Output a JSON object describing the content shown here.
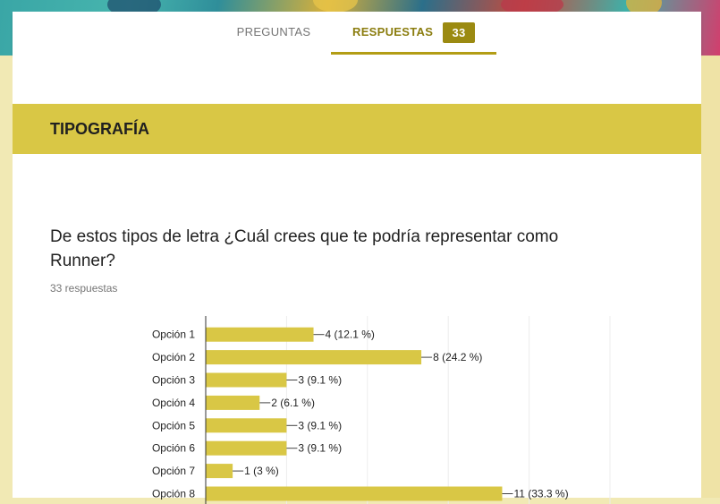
{
  "tabs": {
    "questions_label": "PREGUNTAS",
    "responses_label": "RESPUESTAS",
    "responses_count": "33"
  },
  "section": {
    "title": "TIPOGRAFÍA"
  },
  "question": {
    "text": "De estos tipos de letra ¿Cuál crees que te podría representar como Runner?",
    "responses_summary": "33 respuestas"
  },
  "colors": {
    "accent": "#d9c745",
    "badge": "#9b8a11",
    "bar": "#d9c745"
  },
  "chart_data": {
    "type": "bar",
    "orientation": "horizontal",
    "categories": [
      "Opción 1",
      "Opción 2",
      "Opción 3",
      "Opción 4",
      "Opción 5",
      "Opción 6",
      "Opción 7",
      "Opción 8"
    ],
    "values": [
      4,
      8,
      3,
      2,
      3,
      3,
      1,
      11
    ],
    "labels": [
      "4 (12.1 %)",
      "8 (24.2 %)",
      "3 (9.1 %)",
      "2 (6.1 %)",
      "3 (9.1 %)",
      "3 (9.1 %)",
      "1 (3 %)",
      "11 (33.3 %)"
    ],
    "xlim": [
      0,
      15
    ],
    "grid": true
  }
}
